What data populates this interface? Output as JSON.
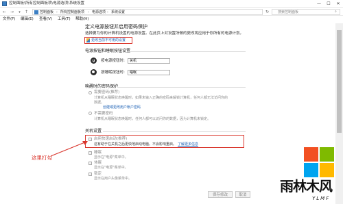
{
  "window": {
    "title": "控制面板\\所有控制面板项\\电源选项\\系统设置",
    "minimize": "—",
    "maximize": "☐",
    "close": "✕"
  },
  "address": {
    "back": "←",
    "forward": "→",
    "up": "↑",
    "crumbs": [
      "控制面板",
      "所有控制面板项",
      "电源选项",
      "系统设置"
    ],
    "separator": "›",
    "refresh": "↻",
    "search_placeholder": "搜索控制面板"
  },
  "menu": [
    "文件(F)",
    "编辑(E)",
    "查看(V)",
    "工具(T)",
    "帮助(H)"
  ],
  "page": {
    "heading": "定义电源按钮并启用密码保护",
    "description": "选择要为你的计算机设置的电源设置。在此页上对设置所做的更改将应用于你所有的电源计划。",
    "change_link": "更改当前不可用的设置",
    "buttons_section": "电源按钮和睡眠按钮设置",
    "power_button_label": "按电源按钮时:",
    "power_button_value": "关机",
    "sleep_button_label": "按睡眠按钮时:",
    "sleep_button_value": "睡眠",
    "wake_section": "唤醒时的密码保护",
    "require_password_title": "需要密码(推荐)",
    "require_password_desc_1": "计算机从睡眠状态唤醒时，如果未输入正确的密码来解锁计算机，任何人都无法访问你的",
    "require_password_desc_2": "数据。",
    "create_password_link": "创建或更改用户帐户密码",
    "no_password_title": "不需要密码",
    "no_password_desc_1": "计算机从睡眠状态唤醒时，任何人都可以访问你的数据，因为计算机未锁定。",
    "shutdown_section": "关机设置",
    "fast_startup_title": "启用快速启动(推荐)",
    "fast_startup_desc": "这有助于在关机之后更快地启动电脑。不会影响重启。",
    "learn_more_link": "了解更多信息",
    "sleep_title": "睡眠",
    "sleep_desc": "显示在\"电源\"菜单中。",
    "hibernate_title": "休眠",
    "hibernate_desc": "显示在\"电源\"菜单中。",
    "lock_title": "锁定",
    "lock_desc": "显示在用户头像菜单中。",
    "save_button": "保存修改",
    "cancel_button": "取消"
  },
  "annotation": {
    "text": "这里打勾",
    "color": "#d9342b"
  },
  "watermark": {
    "brand": "雨林木风",
    "brand_latin": "YLMF",
    "logo_colors": [
      "#f25022",
      "#7fba00",
      "#00a4ef",
      "#ffb900"
    ]
  }
}
